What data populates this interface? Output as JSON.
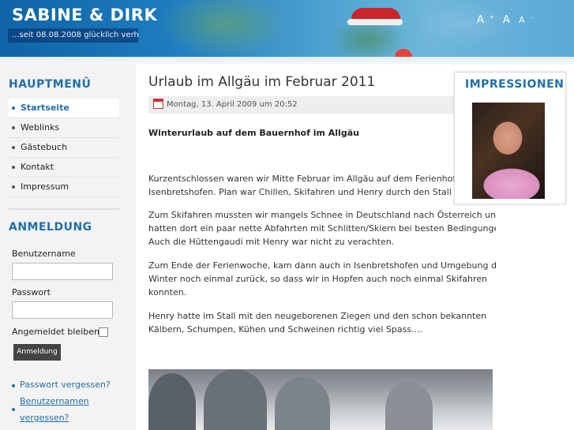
{
  "header": {
    "site_title": "SABINE & DIRK",
    "slogan": "...seit 08.08.2008 glücklich verh",
    "font_controls": [
      "A",
      "A",
      "A"
    ],
    "font_controls_sup": [
      "+",
      "",
      "-"
    ]
  },
  "main_menu": {
    "title": "HAUPTMENÜ",
    "items": [
      {
        "label": "Startseite",
        "active": true
      },
      {
        "label": "Weblinks"
      },
      {
        "label": "Gästebuch"
      },
      {
        "label": "Kontakt"
      },
      {
        "label": "Impressum"
      }
    ]
  },
  "login": {
    "title": "ANMELDUNG",
    "username_label": "Benutzername",
    "password_label": "Passwort",
    "remember_label": "Angemeldet bleiben",
    "button_label": "Anmeldung",
    "links": [
      "Passwort vergessen?",
      "Benutzernamen",
      "vergessen?"
    ]
  },
  "article": {
    "title": "Urlaub im Allgäu im Februar 2011",
    "date": "Montag, 13. April 2009 um 20:52",
    "lead": "Winterurlaub auf dem Bauernhof im Allgäu",
    "paragraphs": [
      [
        "Kurzentschlossen waren wir Mitte Februar im Allgäu auf dem Ferienhof Be",
        "Isenbretshofen. Plan war Chillen, Skifahren und Henry durch den Stall zu"
      ],
      [
        "Zum Skifahren mussten wir mangels Schnee in Deutschland nach Österreich und",
        "hatten dort ein paar nette Abfahrten mit Schlitten/Skiern bei besten Bedingungen.",
        "Auch die Hüttengaudi mit Henry war nicht zu verachten."
      ],
      [
        "Zum Ende der Ferienwoche, kam dann auch in Isenbretshofen und Umgebung der",
        "Winter  noch einmal zurück, so dass wir in Hopfen auch noch einmal Skifahren",
        "konnten."
      ],
      [
        "Henry hatte im Stall mit den neugeborenen Ziegen und den schon bekannten",
        "Kälbern, Schumpen, Kühen und Schweinen richtig viel Spass...."
      ]
    ]
  },
  "impressionen": {
    "title": "IMPRESSIONEN"
  },
  "colors": {
    "accent": "#1f6fa8",
    "header_blue": "#1e7dbf"
  }
}
